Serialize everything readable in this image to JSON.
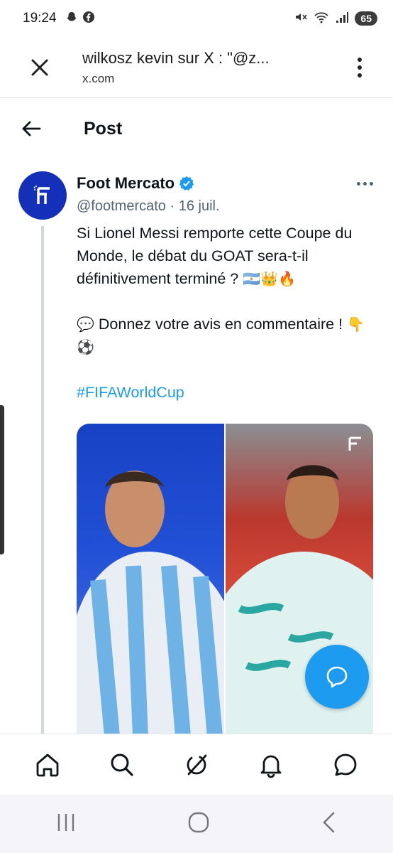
{
  "status_bar": {
    "time": "19:24",
    "battery": "65",
    "left_icons": [
      "snapchat-icon",
      "facebook-icon"
    ],
    "right_icons": [
      "mute-icon",
      "wifi-icon",
      "signal-icon"
    ]
  },
  "browser": {
    "title": "wilkosz kevin sur X : \"@z...",
    "url": "x.com"
  },
  "post_header": {
    "title": "Post"
  },
  "tweet": {
    "author_name": "Foot Mercato",
    "handle": "@footmercato",
    "separator": "·",
    "date": "16 juil.",
    "text_line1": "Si Lionel Messi remporte cette Coupe du Monde, le débat du GOAT sera-t-il définitivement terminé ?",
    "emojis_line1": "🇦🇷👑🔥",
    "text_line2_emoji": "💬",
    "text_line2": "Donnez votre avis en commentaire !",
    "emojis_line2": "👇⚽",
    "hashtag": "#FIFAWorldCup"
  },
  "colors": {
    "accent": "#1d9bf0",
    "avatar_bg": "#1530b8",
    "secondary_text": "#536471"
  }
}
